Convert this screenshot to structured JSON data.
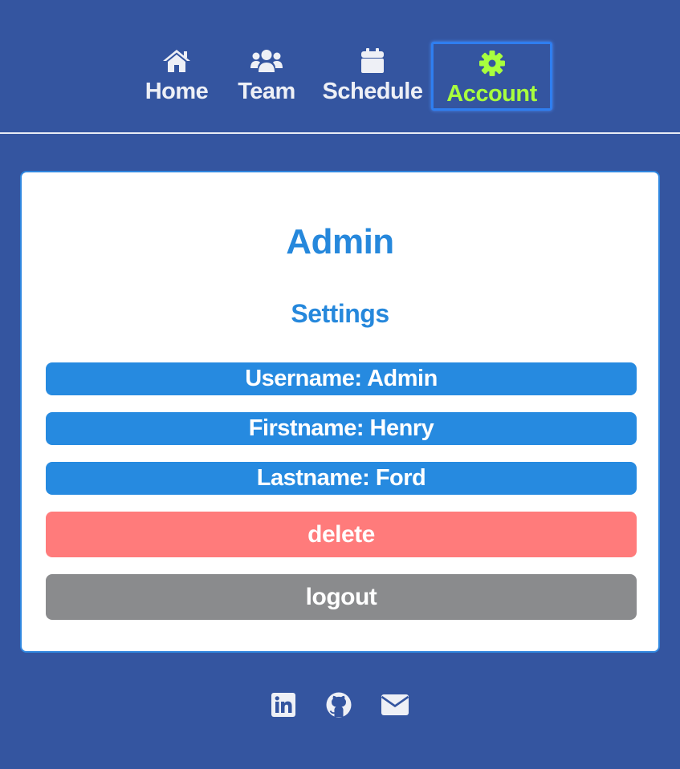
{
  "nav": {
    "items": [
      {
        "label": "Home",
        "icon": "home-icon"
      },
      {
        "label": "Team",
        "icon": "users-icon"
      },
      {
        "label": "Schedule",
        "icon": "calendar-icon"
      },
      {
        "label": "Account",
        "icon": "gear-icon",
        "active": true
      }
    ]
  },
  "card": {
    "title": "Admin",
    "subtitle": "Settings",
    "fields": [
      {
        "text": "Username: Admin"
      },
      {
        "text": "Firstname: Henry"
      },
      {
        "text": "Lastname: Ford"
      }
    ],
    "delete_label": "delete",
    "logout_label": "logout"
  },
  "footer": {
    "icons": [
      "linkedin-icon",
      "github-icon",
      "envelope-icon"
    ]
  },
  "colors": {
    "background": "#3455a0",
    "accent": "#2688dc",
    "active_nav": "#a8ff3e",
    "delete": "#ff7b7b",
    "logout": "#8a8b8d"
  }
}
